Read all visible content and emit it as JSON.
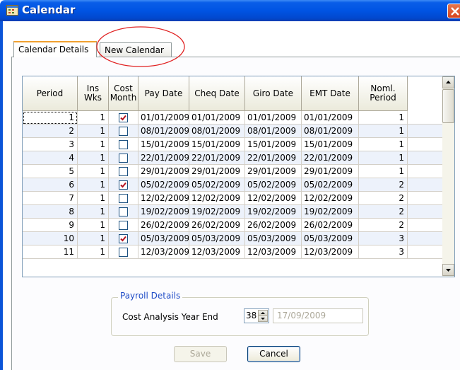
{
  "window": {
    "title": "Calendar",
    "app_icon": "calendar-icon",
    "close_icon": "close-icon"
  },
  "tabs": [
    {
      "label": "Calendar Details",
      "active": true
    },
    {
      "label": "New Calendar",
      "active": false
    }
  ],
  "grid": {
    "columns": [
      "Period",
      "Ins\nWks",
      "Cost\nMonth",
      "Pay Date",
      "Cheq Date",
      "Giro Date",
      "EMT Date",
      "Noml.\nPeriod"
    ],
    "rows": [
      {
        "period": "1",
        "ins_wks": "1",
        "cost_month": true,
        "pay": "01/01/2009",
        "cheq": "01/01/2009",
        "giro": "01/01/2009",
        "emt": "01/01/2009",
        "noml": "1"
      },
      {
        "period": "2",
        "ins_wks": "1",
        "cost_month": false,
        "pay": "08/01/2009",
        "cheq": "08/01/2009",
        "giro": "08/01/2009",
        "emt": "08/01/2009",
        "noml": "1"
      },
      {
        "period": "3",
        "ins_wks": "1",
        "cost_month": false,
        "pay": "15/01/2009",
        "cheq": "15/01/2009",
        "giro": "15/01/2009",
        "emt": "15/01/2009",
        "noml": "1"
      },
      {
        "period": "4",
        "ins_wks": "1",
        "cost_month": false,
        "pay": "22/01/2009",
        "cheq": "22/01/2009",
        "giro": "22/01/2009",
        "emt": "22/01/2009",
        "noml": "1"
      },
      {
        "period": "5",
        "ins_wks": "1",
        "cost_month": false,
        "pay": "29/01/2009",
        "cheq": "29/01/2009",
        "giro": "29/01/2009",
        "emt": "29/01/2009",
        "noml": "1"
      },
      {
        "period": "6",
        "ins_wks": "1",
        "cost_month": true,
        "pay": "05/02/2009",
        "cheq": "05/02/2009",
        "giro": "05/02/2009",
        "emt": "05/02/2009",
        "noml": "2"
      },
      {
        "period": "7",
        "ins_wks": "1",
        "cost_month": false,
        "pay": "12/02/2009",
        "cheq": "12/02/2009",
        "giro": "12/02/2009",
        "emt": "12/02/2009",
        "noml": "2"
      },
      {
        "period": "8",
        "ins_wks": "1",
        "cost_month": false,
        "pay": "19/02/2009",
        "cheq": "19/02/2009",
        "giro": "19/02/2009",
        "emt": "19/02/2009",
        "noml": "2"
      },
      {
        "period": "9",
        "ins_wks": "1",
        "cost_month": false,
        "pay": "26/02/2009",
        "cheq": "26/02/2009",
        "giro": "26/02/2009",
        "emt": "26/02/2009",
        "noml": "2"
      },
      {
        "period": "10",
        "ins_wks": "1",
        "cost_month": true,
        "pay": "05/03/2009",
        "cheq": "05/03/2009",
        "giro": "05/03/2009",
        "emt": "05/03/2009",
        "noml": "3"
      },
      {
        "period": "11",
        "ins_wks": "1",
        "cost_month": false,
        "pay": "12/03/2009",
        "cheq": "12/03/2009",
        "giro": "12/03/2009",
        "emt": "12/03/2009",
        "noml": "3"
      }
    ]
  },
  "payroll_details": {
    "title": "Payroll Details",
    "cost_label": "Cost Analysis Year End",
    "spin_value": "38",
    "date_value": "17/09/2009"
  },
  "buttons": {
    "save": "Save",
    "cancel": "Cancel"
  },
  "colors": {
    "title_bar": "#0054e3",
    "annotation": "#e02020",
    "checkmark": "#b3121e",
    "group_title": "#1f4cc7"
  }
}
